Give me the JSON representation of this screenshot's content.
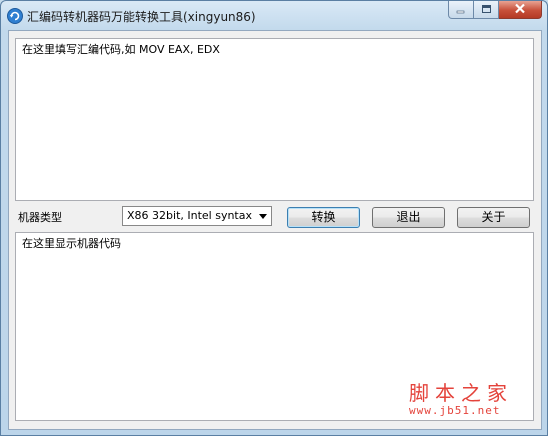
{
  "window": {
    "title": "汇编码转机器码万能转换工具(xingyun86)"
  },
  "input": {
    "text": "在这里填写汇编代码,如 MOV EAX, EDX"
  },
  "controls": {
    "machine_type_label": "机器类型",
    "machine_type_value": "X86 32bit, Intel syntax",
    "convert_label": "转换",
    "exit_label": "退出",
    "about_label": "关于"
  },
  "output": {
    "text": "在这里显示机器代码"
  },
  "watermark": {
    "site_name": "脚本之家",
    "url": "www.jb51.net"
  },
  "colors": {
    "accent": "#3c7fb1",
    "watermark": "#e4433b"
  }
}
